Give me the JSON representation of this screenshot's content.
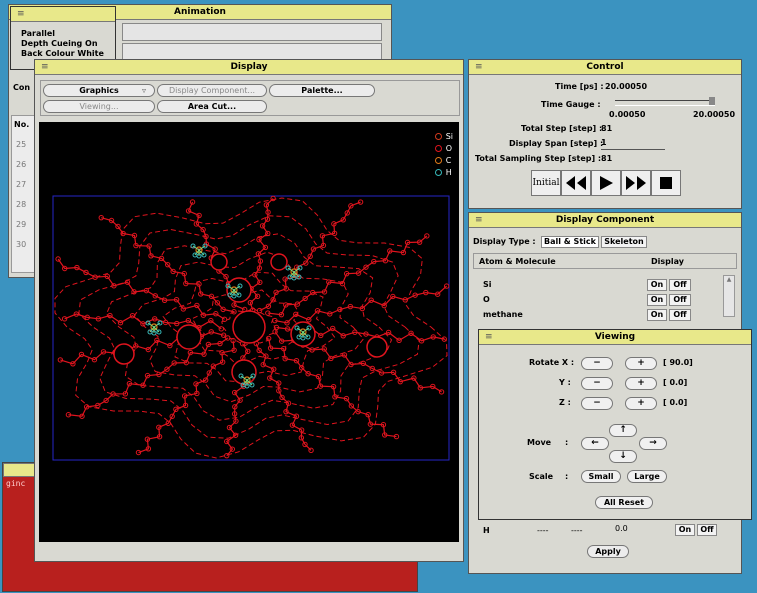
{
  "menu": {
    "items": [
      "Parallel",
      "Depth Cueing On",
      "Back Colour White"
    ]
  },
  "animation_window": {
    "title": "Animation",
    "cutoff_label": "Con",
    "column_header": "No.",
    "rows": [
      "25",
      "26",
      "27",
      "28",
      "29",
      "30"
    ]
  },
  "terminal": {
    "text": "ginc"
  },
  "display_window": {
    "title": "Display",
    "buttons": {
      "graphics": "Graphics",
      "display_component": "Display Component...",
      "palette": "Palette...",
      "viewing": "Viewing...",
      "area_cut": "Area Cut..."
    },
    "legend": [
      {
        "label": "Si",
        "color": "#d23a1e"
      },
      {
        "label": "O",
        "color": "#e0141e"
      },
      {
        "label": "C",
        "color": "#e07a18"
      },
      {
        "label": "H",
        "color": "#37b8b8"
      }
    ]
  },
  "control_window": {
    "title": "Control",
    "time_label": "Time [ps] :",
    "time_value": "20.00050",
    "time_gauge_label": "Time Gauge :",
    "gauge_min": "0.00050",
    "gauge_max": "20.00050",
    "total_step_label": "Total Step [step] :",
    "total_step_value": "81",
    "display_span_label": "Display Span [step] :",
    "display_span_value": "1",
    "total_sampling_label": "Total Sampling Step [step] :",
    "total_sampling_value": "81",
    "initial_label": "Initial"
  },
  "display_component_window": {
    "title": "Display Component",
    "display_type_label": "Display Type :",
    "type_ball_stick": "Ball & Stick",
    "type_skeleton": "Skeleton",
    "col_atom": "Atom & Molecule",
    "col_display": "Display",
    "rows": [
      {
        "name": "Si",
        "on": "On",
        "off": "Off"
      },
      {
        "name": "O",
        "on": "On",
        "off": "Off"
      },
      {
        "name": "methane",
        "on": "On",
        "off": "Off"
      }
    ],
    "bottom_row": {
      "name": "H",
      "val_a": "----",
      "val_b": "----",
      "val_c": "0.0",
      "on": "On",
      "off": "Off"
    },
    "apply": "Apply"
  },
  "viewing_window": {
    "title": "Viewing",
    "rotate_x": "Rotate X :",
    "y": "Y :",
    "z": "Z :",
    "minus": "−",
    "plus": "+",
    "rx_val": "[ 90.0]",
    "ry_val": "[  0.0]",
    "rz_val": "[  0.0]",
    "move": "Move",
    "colon": ":",
    "scale": "Scale",
    "small": "Small",
    "large": "Large",
    "all_reset": "All Reset"
  }
}
